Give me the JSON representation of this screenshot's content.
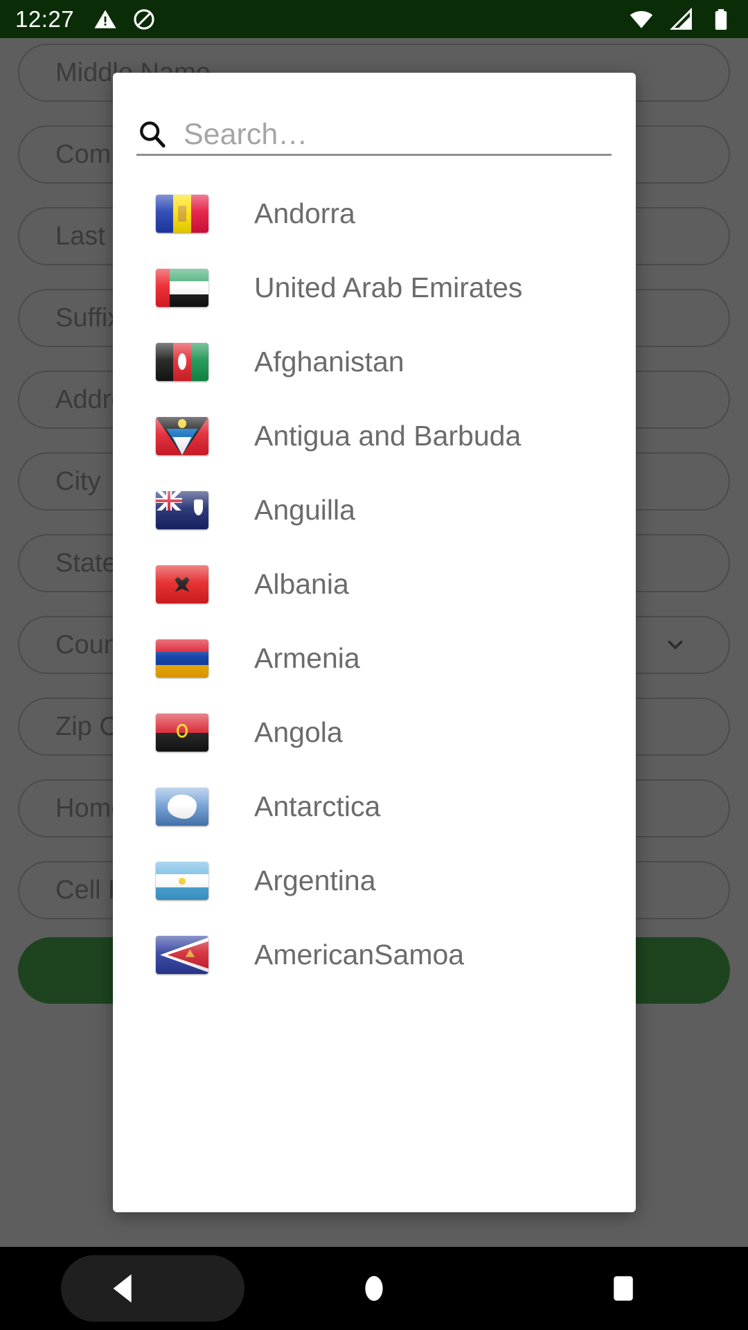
{
  "status_bar": {
    "time": "12:27",
    "left_icons": [
      "warning-triangle-icon",
      "do-not-disturb-icon"
    ],
    "right_icons": [
      "wifi-icon",
      "cell-signal-icon",
      "battery-icon"
    ],
    "background_color": "#0a2d08"
  },
  "background_form": {
    "fields": [
      {
        "label": "Middle Name",
        "has_chevron": false
      },
      {
        "label": "Company",
        "has_chevron": false
      },
      {
        "label": "Last Name",
        "has_chevron": false
      },
      {
        "label": "Suffix",
        "has_chevron": false
      },
      {
        "label": "Address",
        "has_chevron": false
      },
      {
        "label": "City",
        "has_chevron": false
      },
      {
        "label": "State",
        "has_chevron": false
      },
      {
        "label": "Country",
        "has_chevron": true
      },
      {
        "label": "Zip Code",
        "has_chevron": false
      },
      {
        "label": "Home Phone",
        "has_chevron": false
      },
      {
        "label": "Cell Phone",
        "has_chevron": false
      }
    ],
    "submit_button_color": "#1e4620"
  },
  "dialog": {
    "search": {
      "placeholder": "Search…",
      "value": "",
      "icon": "search-icon"
    },
    "countries": [
      {
        "name": "Andorra",
        "flag": "andorra-flag-icon"
      },
      {
        "name": "United Arab Emirates",
        "flag": "united-arab-emirates-flag-icon"
      },
      {
        "name": "Afghanistan",
        "flag": "afghanistan-flag-icon"
      },
      {
        "name": "Antigua and Barbuda",
        "flag": "antigua-and-barbuda-flag-icon"
      },
      {
        "name": "Anguilla",
        "flag": "anguilla-flag-icon"
      },
      {
        "name": "Albania",
        "flag": "albania-flag-icon"
      },
      {
        "name": "Armenia",
        "flag": "armenia-flag-icon"
      },
      {
        "name": "Angola",
        "flag": "angola-flag-icon"
      },
      {
        "name": "Antarctica",
        "flag": "antarctica-flag-icon"
      },
      {
        "name": "Argentina",
        "flag": "argentina-flag-icon"
      },
      {
        "name": "AmericanSamoa",
        "flag": "american-samoa-flag-icon"
      }
    ]
  },
  "nav_bar": {
    "buttons": [
      "back-button",
      "home-button",
      "recents-button"
    ]
  },
  "colors": {
    "status_bar_green": "#0a2d08",
    "scrim_gray": "#606060",
    "dialog_white": "#ffffff",
    "list_text_gray": "#6b6b6b",
    "placeholder_gray": "#a5a5a5",
    "submit_green": "#1e4620"
  }
}
